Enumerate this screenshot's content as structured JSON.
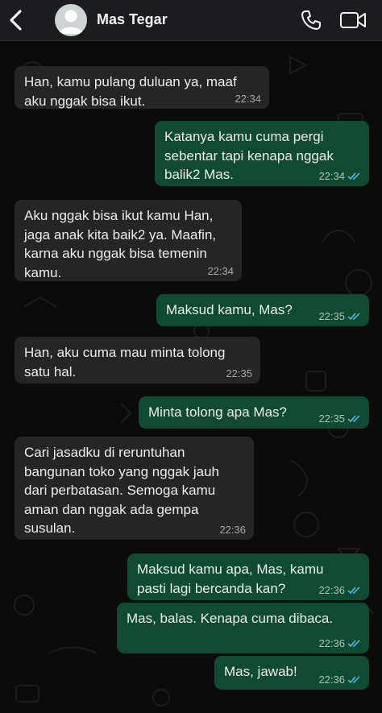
{
  "header": {
    "contact_name": "Mas Tegar"
  },
  "messages": [
    {
      "direction": "in",
      "text": "Han, kamu pulang duluan ya, maaf\naku nggak bisa ikut.",
      "time": "22:34"
    },
    {
      "direction": "out",
      "text": "Katanya kamu cuma pergi\nsebentar tapi kenapa nggak\nbalik2 Mas.",
      "time": "22:34"
    },
    {
      "direction": "in",
      "text": "Aku nggak bisa ikut kamu Han,\njaga anak kita baik2 ya. Maafin,\nkarna aku nggak bisa temenin\nkamu.",
      "time": "22:34"
    },
    {
      "direction": "out",
      "text": "Maksud kamu, Mas?",
      "time": "22:35"
    },
    {
      "direction": "in",
      "text": "Han, aku cuma mau minta tolong\nsatu hal.",
      "time": "22:35"
    },
    {
      "direction": "out",
      "text": "Minta tolong apa Mas?",
      "time": "22:35"
    },
    {
      "direction": "in",
      "text": "Cari jasadku di reruntuhan\nbangunan toko yang nggak jauh\ndari perbatasan. Semoga kamu\naman dan nggak ada gempa\nsusulan.",
      "time": "22:36"
    },
    {
      "direction": "out",
      "text": "Maksud kamu apa, Mas, kamu\npasti lagi bercanda kan?",
      "time": "22:36"
    },
    {
      "direction": "out",
      "text": "Mas, balas. Kenapa cuma dibaca.",
      "time": "22:36"
    },
    {
      "direction": "out",
      "text": "Mas, jawab!",
      "time": "22:36"
    }
  ],
  "colors": {
    "incoming_bubble": "#252525",
    "outgoing_bubble": "#104a32",
    "read_ticks": "#53bdeb"
  },
  "icons": [
    "chevron-left-icon",
    "avatar-placeholder-icon",
    "phone-icon",
    "video-camera-icon",
    "double-check-read-icon"
  ]
}
